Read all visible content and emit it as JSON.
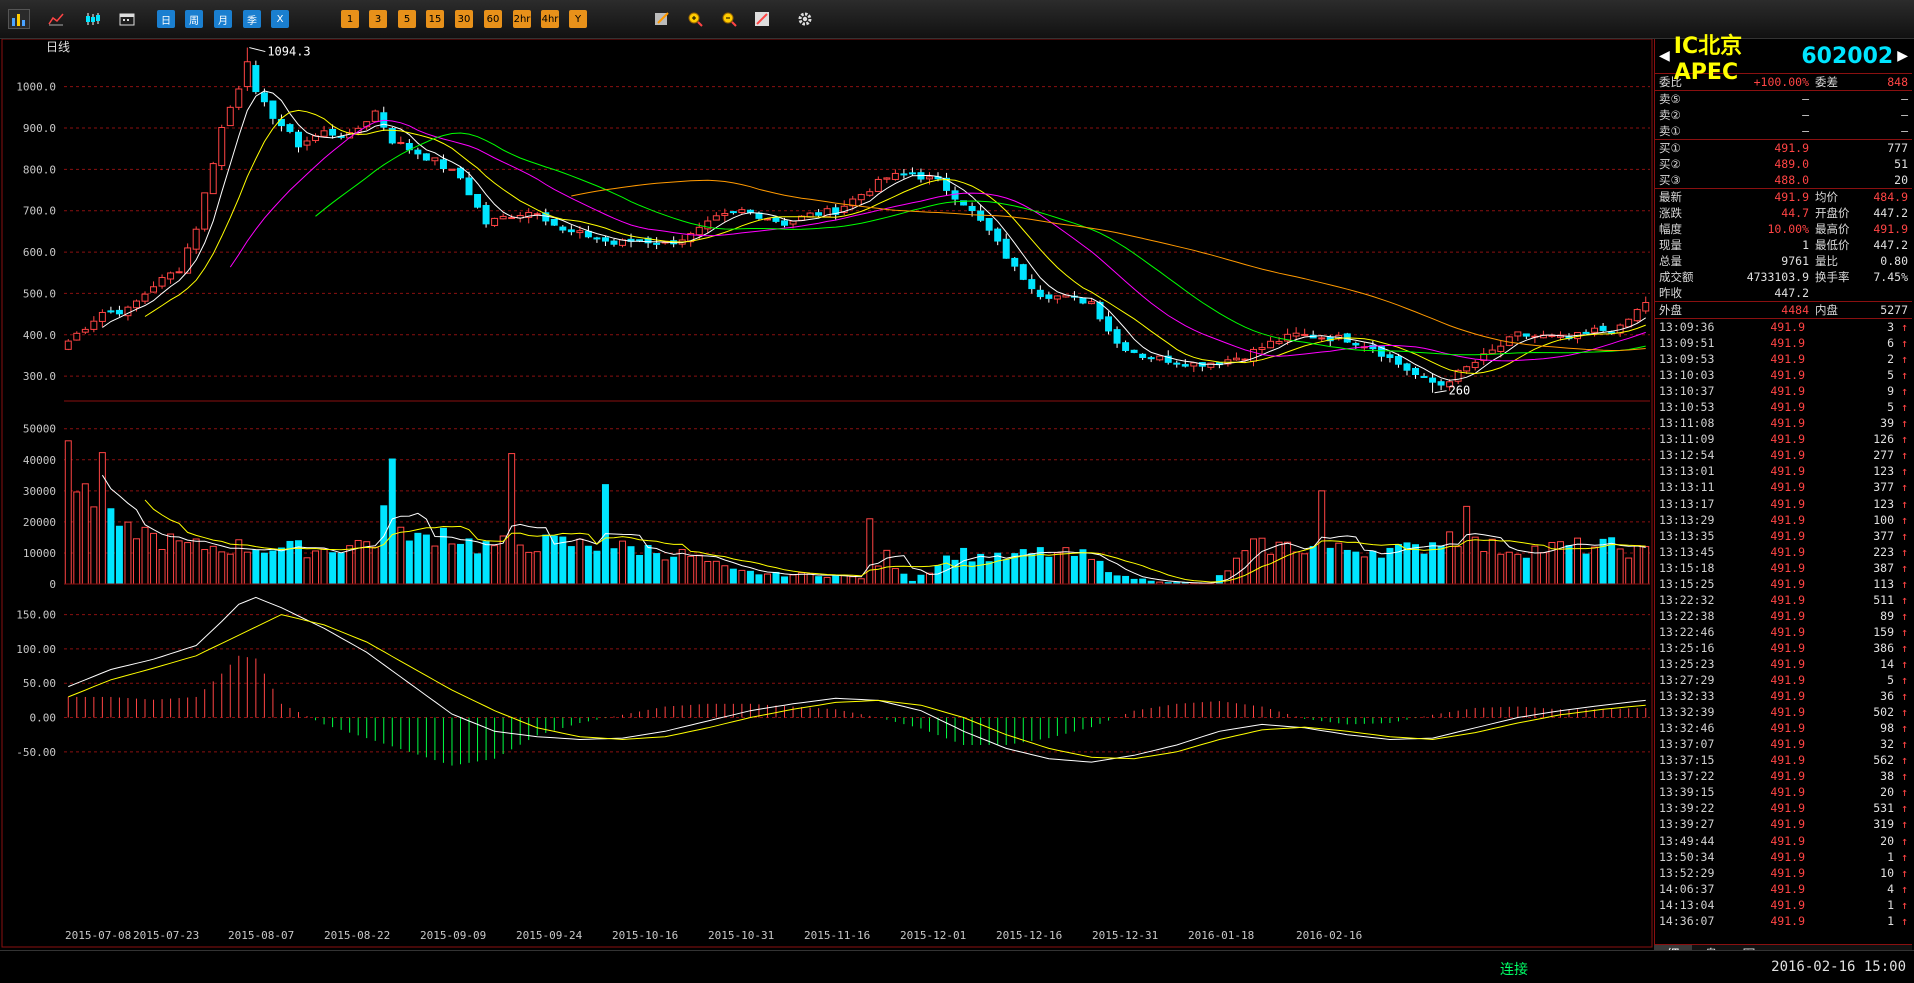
{
  "toolbar": {
    "icons": [
      "kline-chart-icon",
      "line-chart-icon",
      "candlestick-icon",
      "calendar-icon"
    ],
    "period_buttons": [
      {
        "label": "日",
        "kind": "blue"
      },
      {
        "label": "周",
        "kind": "blue"
      },
      {
        "label": "月",
        "kind": "blue"
      },
      {
        "label": "季",
        "kind": "blue"
      },
      {
        "label": "X",
        "kind": "blue"
      },
      {
        "label": "1",
        "kind": "orange"
      },
      {
        "label": "3",
        "kind": "orange"
      },
      {
        "label": "5",
        "kind": "orange"
      },
      {
        "label": "15",
        "kind": "orange"
      },
      {
        "label": "30",
        "kind": "orange"
      },
      {
        "label": "60",
        "kind": "orange"
      },
      {
        "label": "2hr",
        "kind": "orange"
      },
      {
        "label": "4hr",
        "kind": "orange"
      },
      {
        "label": "Y",
        "kind": "orange"
      }
    ],
    "tool_icons": [
      "edit-icon",
      "zoom-in-icon",
      "zoom-out-icon",
      "draw-line-icon",
      "gear-icon"
    ]
  },
  "chart": {
    "period_label": "日线",
    "colors": {
      "up": "#ff4444",
      "down": "#00e5ff",
      "ma5": "#ffffff",
      "ma10": "#ffff00",
      "ma20": "#ff00ff",
      "ma30": "#00ff00",
      "ma60": "#ff9900",
      "grid": "#8a1010"
    },
    "high_label": "1094.3",
    "low_label": "260"
  },
  "chart_data": [
    {
      "type": "candlestick",
      "title": "日线",
      "ylim": [
        240,
        1115
      ],
      "yticks": [
        "1000.0",
        "900.0",
        "800.0",
        "700.0",
        "600.0",
        "500.0",
        "400.0",
        "300.0"
      ],
      "ytick_values": [
        1000,
        900,
        800,
        700,
        600,
        500,
        400,
        300
      ],
      "xtick_labels": [
        "2015-07-08",
        "2015-07-23",
        "2015-08-07",
        "2015-08-22",
        "2015-09-09",
        "2015-09-24",
        "2015-10-16",
        "2015-10-31",
        "2015-11-16",
        "2015-12-01",
        "2015-12-16",
        "2015-12-31",
        "2016-01-18",
        "2016-02-16"
      ],
      "close_anchors": [
        [
          0,
          385
        ],
        [
          2,
          420
        ],
        [
          4,
          455
        ],
        [
          7,
          460
        ],
        [
          10,
          520
        ],
        [
          13,
          560
        ],
        [
          15,
          660
        ],
        [
          18,
          900
        ],
        [
          20,
          1000
        ],
        [
          21,
          1060
        ],
        [
          22,
          980
        ],
        [
          24,
          930
        ],
        [
          27,
          860
        ],
        [
          30,
          890
        ],
        [
          33,
          880
        ],
        [
          36,
          940
        ],
        [
          38,
          870
        ],
        [
          40,
          850
        ],
        [
          43,
          820
        ],
        [
          46,
          780
        ],
        [
          49,
          670
        ],
        [
          52,
          690
        ],
        [
          55,
          700
        ],
        [
          58,
          650
        ],
        [
          61,
          640
        ],
        [
          64,
          620
        ],
        [
          67,
          630
        ],
        [
          70,
          620
        ],
        [
          73,
          640
        ],
        [
          76,
          680
        ],
        [
          79,
          700
        ],
        [
          81,
          690
        ],
        [
          84,
          670
        ],
        [
          87,
          690
        ],
        [
          90,
          700
        ],
        [
          93,
          740
        ],
        [
          96,
          780
        ],
        [
          99,
          790
        ],
        [
          102,
          770
        ],
        [
          105,
          720
        ],
        [
          108,
          650
        ],
        [
          111,
          560
        ],
        [
          114,
          500
        ],
        [
          117,
          490
        ],
        [
          120,
          480
        ],
        [
          123,
          380
        ],
        [
          126,
          350
        ],
        [
          129,
          340
        ],
        [
          132,
          330
        ],
        [
          135,
          335
        ],
        [
          138,
          350
        ],
        [
          141,
          380
        ],
        [
          144,
          400
        ],
        [
          147,
          395
        ],
        [
          150,
          390
        ],
        [
          153,
          370
        ],
        [
          156,
          330
        ],
        [
          159,
          290
        ],
        [
          161,
          280
        ],
        [
          164,
          320
        ],
        [
          167,
          360
        ],
        [
          170,
          400
        ],
        [
          173,
          395
        ],
        [
          176,
          390
        ],
        [
          179,
          410
        ],
        [
          182,
          415
        ],
        [
          185,
          480
        ]
      ],
      "n_bars": 186
    },
    {
      "type": "bar",
      "title": "volume",
      "ylim": [
        0,
        57000
      ],
      "yticks": [
        "50000",
        "40000",
        "30000",
        "20000",
        "10000",
        "0"
      ],
      "ytick_values": [
        50000,
        40000,
        30000,
        20000,
        10000,
        0
      ],
      "volume_anchors": [
        [
          0,
          55000
        ],
        [
          1,
          30000
        ],
        [
          3,
          28000
        ],
        [
          4,
          34000
        ],
        [
          6,
          15000
        ],
        [
          8,
          18000
        ],
        [
          10,
          15000
        ],
        [
          14,
          12000
        ],
        [
          20,
          12000
        ],
        [
          30,
          11000
        ],
        [
          36,
          14000
        ],
        [
          38,
          33000
        ],
        [
          40,
          13000
        ],
        [
          44,
          17000
        ],
        [
          48,
          12000
        ],
        [
          53,
          13000
        ],
        [
          58,
          13000
        ],
        [
          63,
          12000
        ],
        [
          68,
          11000
        ],
        [
          73,
          9000
        ],
        [
          78,
          4000
        ],
        [
          83,
          3000
        ],
        [
          88,
          3000
        ],
        [
          93,
          2000
        ],
        [
          96,
          9000
        ],
        [
          99,
          1000
        ],
        [
          104,
          10000
        ],
        [
          109,
          8000
        ],
        [
          114,
          10000
        ],
        [
          119,
          9000
        ],
        [
          124,
          2000
        ],
        [
          129,
          500
        ],
        [
          134,
          0
        ],
        [
          139,
          12000
        ],
        [
          144,
          12000
        ],
        [
          149,
          11000
        ],
        [
          154,
          11000
        ],
        [
          158,
          11000
        ],
        [
          162,
          16000
        ],
        [
          166,
          12000
        ],
        [
          171,
          11000
        ],
        [
          176,
          12000
        ],
        [
          181,
          12000
        ],
        [
          185,
          10000
        ]
      ],
      "spikes": [
        [
          52,
          42000
        ],
        [
          63,
          32000
        ],
        [
          94,
          21000
        ],
        [
          134,
          300
        ],
        [
          147,
          30000
        ],
        [
          164,
          25000
        ]
      ]
    },
    {
      "type": "line",
      "title": "macd",
      "ylim": [
        -75,
        180
      ],
      "yticks": [
        "150.00",
        "100.00",
        "50.00",
        "0.00",
        "-50.00"
      ],
      "ytick_values": [
        150,
        100,
        50,
        0,
        -50
      ],
      "dif_anchors": [
        [
          0,
          45
        ],
        [
          5,
          70
        ],
        [
          10,
          85
        ],
        [
          15,
          105
        ],
        [
          18,
          140
        ],
        [
          20,
          165
        ],
        [
          22,
          175
        ],
        [
          25,
          160
        ],
        [
          30,
          130
        ],
        [
          35,
          95
        ],
        [
          40,
          50
        ],
        [
          45,
          5
        ],
        [
          50,
          -20
        ],
        [
          55,
          -28
        ],
        [
          60,
          -32
        ],
        [
          65,
          -30
        ],
        [
          70,
          -20
        ],
        [
          75,
          -5
        ],
        [
          80,
          10
        ],
        [
          85,
          20
        ],
        [
          90,
          28
        ],
        [
          95,
          25
        ],
        [
          100,
          10
        ],
        [
          105,
          -20
        ],
        [
          110,
          -45
        ],
        [
          115,
          -60
        ],
        [
          120,
          -65
        ],
        [
          125,
          -55
        ],
        [
          130,
          -40
        ],
        [
          135,
          -20
        ],
        [
          140,
          -10
        ],
        [
          145,
          -15
        ],
        [
          150,
          -25
        ],
        [
          155,
          -32
        ],
        [
          160,
          -30
        ],
        [
          165,
          -15
        ],
        [
          170,
          0
        ],
        [
          175,
          10
        ],
        [
          180,
          18
        ],
        [
          185,
          25
        ]
      ],
      "dea_anchors": [
        [
          0,
          30
        ],
        [
          5,
          55
        ],
        [
          10,
          72
        ],
        [
          15,
          90
        ],
        [
          20,
          120
        ],
        [
          25,
          150
        ],
        [
          30,
          135
        ],
        [
          35,
          110
        ],
        [
          40,
          75
        ],
        [
          45,
          40
        ],
        [
          50,
          10
        ],
        [
          55,
          -15
        ],
        [
          60,
          -28
        ],
        [
          65,
          -32
        ],
        [
          70,
          -28
        ],
        [
          75,
          -15
        ],
        [
          80,
          0
        ],
        [
          85,
          12
        ],
        [
          90,
          22
        ],
        [
          95,
          25
        ],
        [
          100,
          18
        ],
        [
          105,
          0
        ],
        [
          110,
          -25
        ],
        [
          115,
          -45
        ],
        [
          120,
          -58
        ],
        [
          125,
          -60
        ],
        [
          130,
          -50
        ],
        [
          135,
          -32
        ],
        [
          140,
          -18
        ],
        [
          145,
          -14
        ],
        [
          150,
          -20
        ],
        [
          155,
          -28
        ],
        [
          160,
          -32
        ],
        [
          165,
          -22
        ],
        [
          170,
          -8
        ],
        [
          175,
          4
        ],
        [
          180,
          12
        ],
        [
          185,
          18
        ]
      ]
    }
  ],
  "quote": {
    "name": "IC北京APEC",
    "code": "602002",
    "webi_label": "委比",
    "webi_value": "+100.00%",
    "weicha_label": "委差",
    "weicha_value": "848",
    "asks": [
      {
        "label": "卖⑤",
        "price": "—",
        "vol": "—"
      },
      {
        "label": "卖②",
        "price": "—",
        "vol": "—"
      },
      {
        "label": "卖①",
        "price": "—",
        "vol": "—"
      }
    ],
    "bids": [
      {
        "label": "买①",
        "price": "491.9",
        "vol": "777"
      },
      {
        "label": "买②",
        "price": "489.0",
        "vol": "51"
      },
      {
        "label": "买③",
        "price": "488.0",
        "vol": "20"
      }
    ],
    "stats": [
      {
        "l1": "最新",
        "v1": "491.9",
        "c1": "red",
        "l2": "均价",
        "v2": "484.9",
        "c2": "red"
      },
      {
        "l1": "涨跌",
        "v1": "44.7",
        "c1": "red",
        "l2": "开盘价",
        "v2": "447.2",
        "c2": "wht"
      },
      {
        "l1": "幅度",
        "v1": "10.00%",
        "c1": "red",
        "l2": "最高价",
        "v2": "491.9",
        "c2": "red"
      },
      {
        "l1": "现量",
        "v1": "1",
        "c1": "wht",
        "l2": "最低价",
        "v2": "447.2",
        "c2": "wht"
      },
      {
        "l1": "总量",
        "v1": "9761",
        "c1": "wht",
        "l2": "量比",
        "v2": "0.80",
        "c2": "wht"
      },
      {
        "l1": "成交额",
        "v1": "4733103.9",
        "c1": "wht",
        "l2": "换手率",
        "v2": "7.45%",
        "c2": "wht"
      },
      {
        "l1": "昨收",
        "v1": "447.2",
        "c1": "wht",
        "l2": "",
        "v2": "",
        "c2": "wht"
      }
    ],
    "outer_label": "外盘",
    "outer_value": "4484",
    "inner_label": "内盘",
    "inner_value": "5277"
  },
  "ticks": [
    {
      "t": "13:09:36",
      "p": "491.9",
      "v": "3"
    },
    {
      "t": "13:09:51",
      "p": "491.9",
      "v": "6"
    },
    {
      "t": "13:09:53",
      "p": "491.9",
      "v": "2"
    },
    {
      "t": "13:10:03",
      "p": "491.9",
      "v": "5"
    },
    {
      "t": "13:10:37",
      "p": "491.9",
      "v": "9"
    },
    {
      "t": "13:10:53",
      "p": "491.9",
      "v": "5"
    },
    {
      "t": "13:11:08",
      "p": "491.9",
      "v": "39"
    },
    {
      "t": "13:11:09",
      "p": "491.9",
      "v": "126"
    },
    {
      "t": "13:12:54",
      "p": "491.9",
      "v": "277"
    },
    {
      "t": "13:13:01",
      "p": "491.9",
      "v": "123"
    },
    {
      "t": "13:13:11",
      "p": "491.9",
      "v": "377"
    },
    {
      "t": "13:13:17",
      "p": "491.9",
      "v": "123"
    },
    {
      "t": "13:13:29",
      "p": "491.9",
      "v": "100"
    },
    {
      "t": "13:13:35",
      "p": "491.9",
      "v": "377"
    },
    {
      "t": "13:13:45",
      "p": "491.9",
      "v": "223"
    },
    {
      "t": "13:15:18",
      "p": "491.9",
      "v": "387"
    },
    {
      "t": "13:15:25",
      "p": "491.9",
      "v": "113"
    },
    {
      "t": "13:22:32",
      "p": "491.9",
      "v": "511"
    },
    {
      "t": "13:22:38",
      "p": "491.9",
      "v": "89"
    },
    {
      "t": "13:22:46",
      "p": "491.9",
      "v": "159"
    },
    {
      "t": "13:25:16",
      "p": "491.9",
      "v": "386"
    },
    {
      "t": "13:25:23",
      "p": "491.9",
      "v": "14"
    },
    {
      "t": "13:27:29",
      "p": "491.9",
      "v": "5"
    },
    {
      "t": "13:32:33",
      "p": "491.9",
      "v": "36"
    },
    {
      "t": "13:32:39",
      "p": "491.9",
      "v": "502"
    },
    {
      "t": "13:32:46",
      "p": "491.9",
      "v": "98"
    },
    {
      "t": "13:37:07",
      "p": "491.9",
      "v": "32"
    },
    {
      "t": "13:37:15",
      "p": "491.9",
      "v": "562"
    },
    {
      "t": "13:37:22",
      "p": "491.9",
      "v": "38"
    },
    {
      "t": "13:39:15",
      "p": "491.9",
      "v": "20"
    },
    {
      "t": "13:39:22",
      "p": "491.9",
      "v": "531"
    },
    {
      "t": "13:39:27",
      "p": "491.9",
      "v": "319"
    },
    {
      "t": "13:49:44",
      "p": "491.9",
      "v": "20"
    },
    {
      "t": "13:50:34",
      "p": "491.9",
      "v": "1"
    },
    {
      "t": "13:52:29",
      "p": "491.9",
      "v": "10"
    },
    {
      "t": "14:06:37",
      "p": "491.9",
      "v": "4"
    },
    {
      "t": "14:13:04",
      "p": "491.9",
      "v": "1"
    },
    {
      "t": "14:36:07",
      "p": "491.9",
      "v": "1"
    }
  ],
  "tick_arrow": "↑",
  "side_tabs": [
    "细",
    "盘",
    "图"
  ],
  "status": {
    "connection": "连接",
    "datetime": "2016-02-16 15:00"
  }
}
